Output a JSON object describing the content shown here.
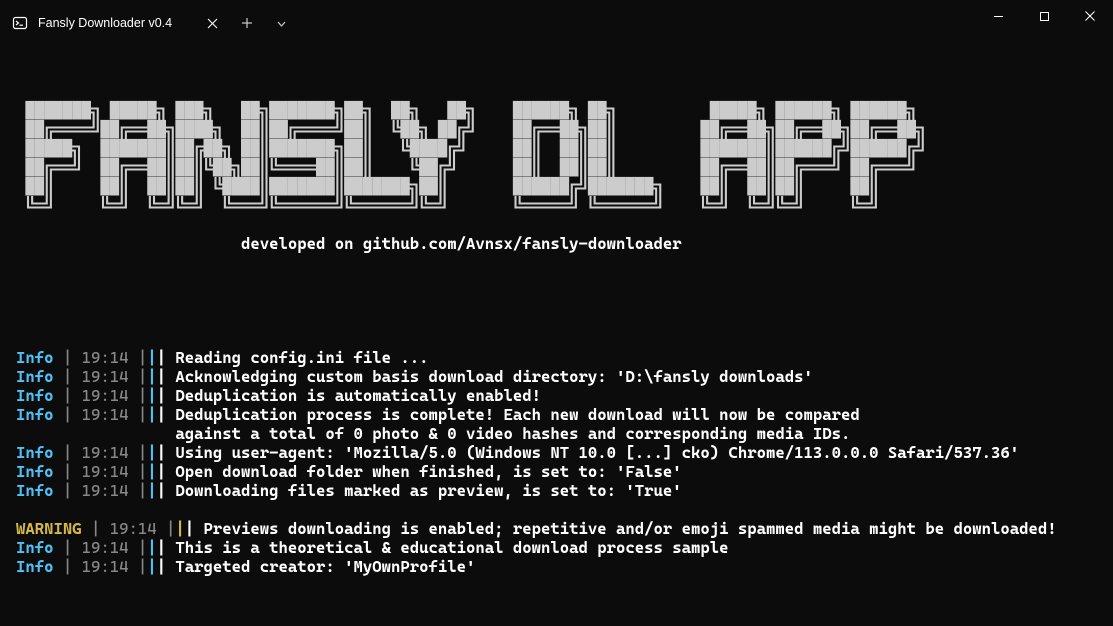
{
  "titlebar": {
    "tab_title": "Fansly Downloader v0.4"
  },
  "banner": {
    "ascii": " ███████╗ █████╗ ███╗   ██╗███████╗██╗  ██╗   ██╗    ██████╗ ██╗          █████╗ ██████╗ ██████╗ \n ██╔════╝██╔══██╗████╗  ██║██╔════╝██║  ╚██╗ ██╔╝    ██╔══██╗██║         ██╔══██╗██╔══██╗██╔══██╗\n █████╗  ███████║██╔██╗ ██║███████╗██║   ╚████╔╝     ██║  ██║██║         ███████║██████╔╝██████╔╝\n ██╔══╝  ██╔══██║██║╚██╗██║╚════██║██║    ╚██╔╝      ██║  ██║██║         ██╔══██║██╔═══╝ ██╔═══╝ \n ██║     ██║  ██║██║ ╚████║███████║███████╗██║       ██████╔╝███████╗    ██║  ██║██║     ██║     \n ╚═╝     ╚═╝  ╚═╝╚═╝  ╚═══╝╚══════╝╚══════╝╚═╝       ╚═════╝ ╚══════╝    ╚═╝  ╚═╝╚═╝     ╚═╝     ",
    "subtitle": "                        developed on github.com/Avnsx/fansly-downloader"
  },
  "logs": [
    {
      "level": "Info",
      "time": "19:14",
      "msg": "Reading config.ini file ..."
    },
    {
      "level": "Info",
      "time": "19:14",
      "msg": "Acknowledging custom basis download directory: 'D:\\fansly downloads'"
    },
    {
      "level": "Info",
      "time": "19:14",
      "msg": "Deduplication is automatically enabled!"
    },
    {
      "level": "Info",
      "time": "19:14",
      "msg": "Deduplication process is complete! Each new download will now be compared\n                 against a total of 0 photo & 0 video hashes and corresponding media IDs."
    },
    {
      "level": "Info",
      "time": "19:14",
      "msg": "Using user-agent: 'Mozilla/5.0 (Windows NT 10.0 [...] cko) Chrome/113.0.0.0 Safari/537.36'"
    },
    {
      "level": "Info",
      "time": "19:14",
      "msg": "Open download folder when finished, is set to: 'False'"
    },
    {
      "level": "Info",
      "time": "19:14",
      "msg": "Downloading files marked as preview, is set to: 'True'"
    },
    {
      "level": "BLANK"
    },
    {
      "level": "WARNING",
      "time": "19:14",
      "msg": "Previews downloading is enabled; repetitive and/or emoji spammed media might be downloaded!"
    },
    {
      "level": "Info",
      "time": "19:14",
      "msg": "This is a theoretical & educational download process sample"
    },
    {
      "level": "Info",
      "time": "19:14",
      "msg": "Targeted creator: 'MyOwnProfile'"
    }
  ]
}
